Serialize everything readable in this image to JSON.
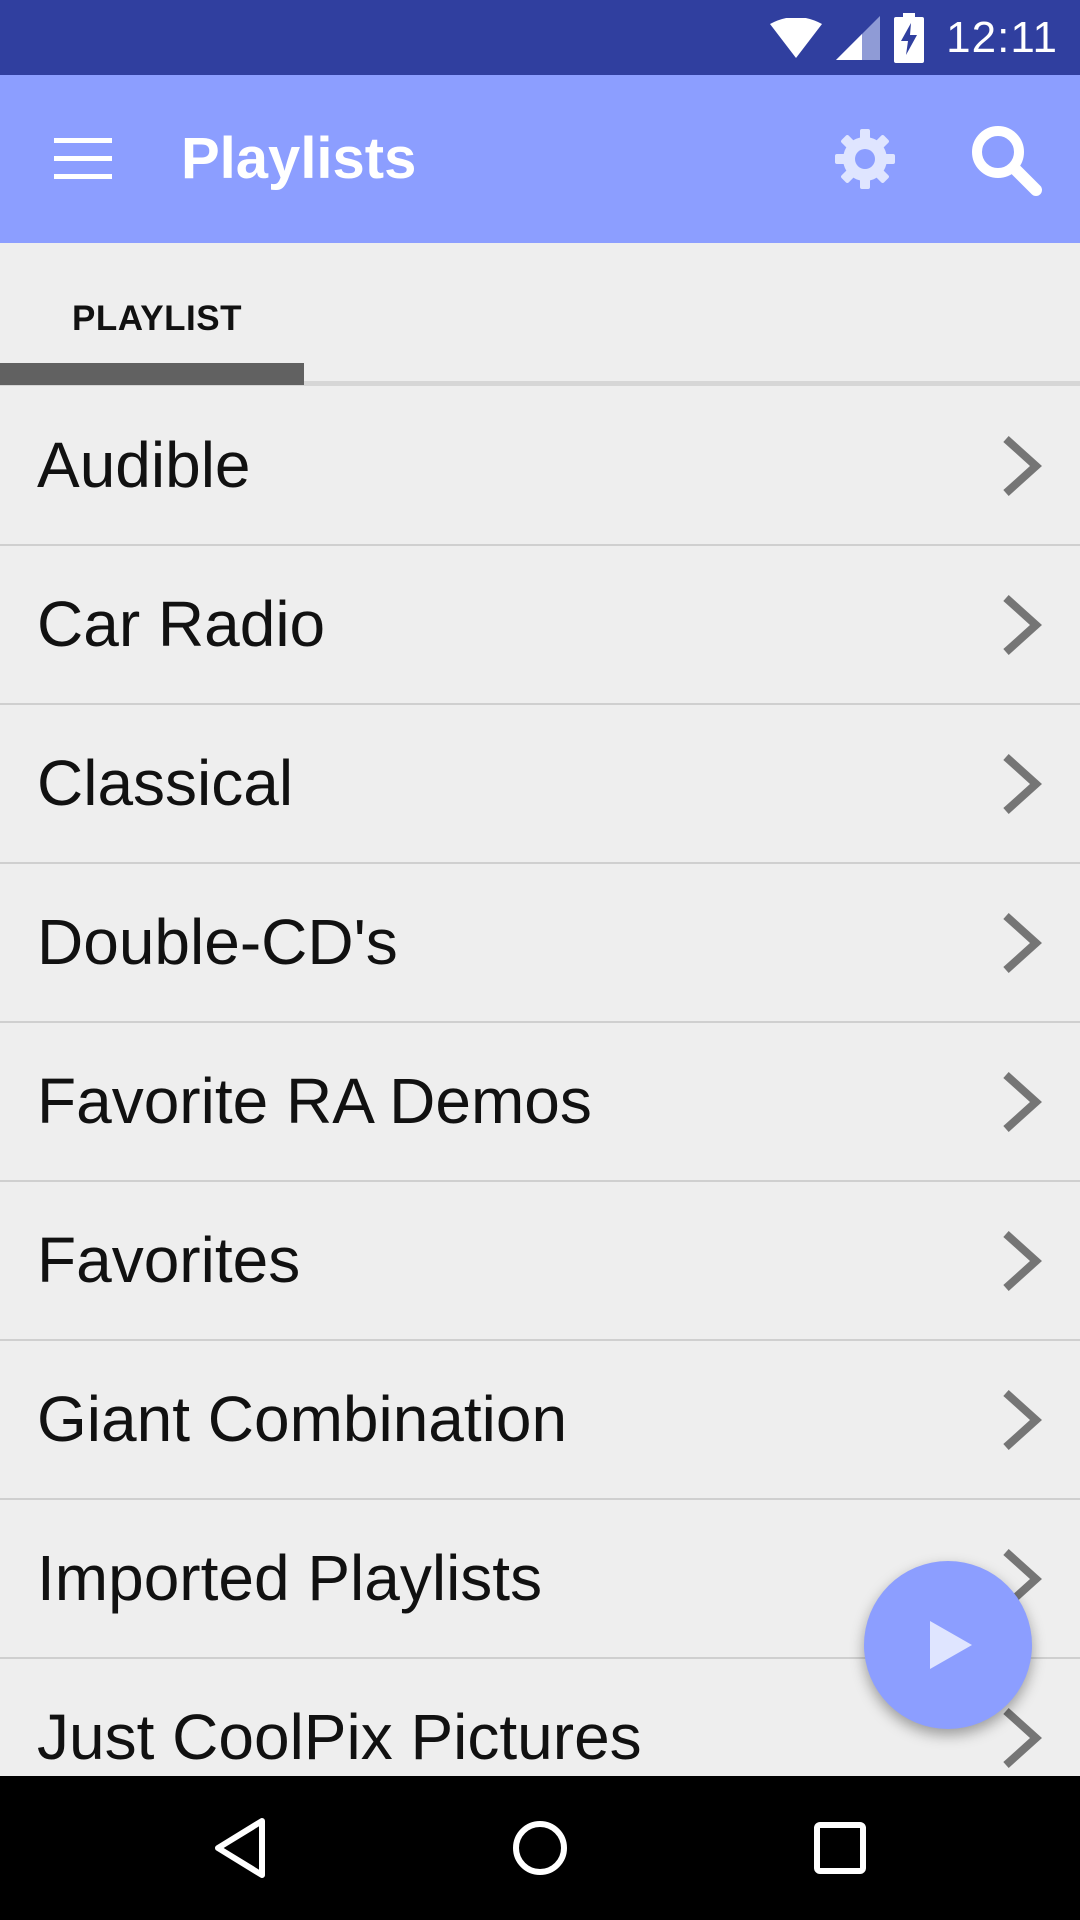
{
  "status_bar": {
    "time": "12:11",
    "icons": [
      "wifi-icon",
      "signal-icon",
      "battery-charging-icon"
    ]
  },
  "app_bar": {
    "title": "Playlists",
    "background": "#8c9eff",
    "icons": [
      "menu-icon",
      "settings-gear-icon",
      "search-icon"
    ]
  },
  "tabs": [
    {
      "label": "PLAYLIST",
      "selected": true
    }
  ],
  "playlists": [
    {
      "name": "Audible"
    },
    {
      "name": "Car Radio"
    },
    {
      "name": "Classical"
    },
    {
      "name": "Double-CD's"
    },
    {
      "name": "Favorite RA Demos"
    },
    {
      "name": "Favorites"
    },
    {
      "name": "Giant Combination"
    },
    {
      "name": "Imported Playlists"
    },
    {
      "name": "Just CoolPix Pictures"
    }
  ],
  "fab": {
    "icon": "play-icon",
    "color": "#8c9eff"
  },
  "nav_bar": {
    "icons": [
      "back-icon",
      "home-icon",
      "recents-icon"
    ]
  },
  "colors": {
    "status_bar": "#303f9f",
    "accent": "#8c9eff",
    "list_bg": "#eeeeee"
  }
}
